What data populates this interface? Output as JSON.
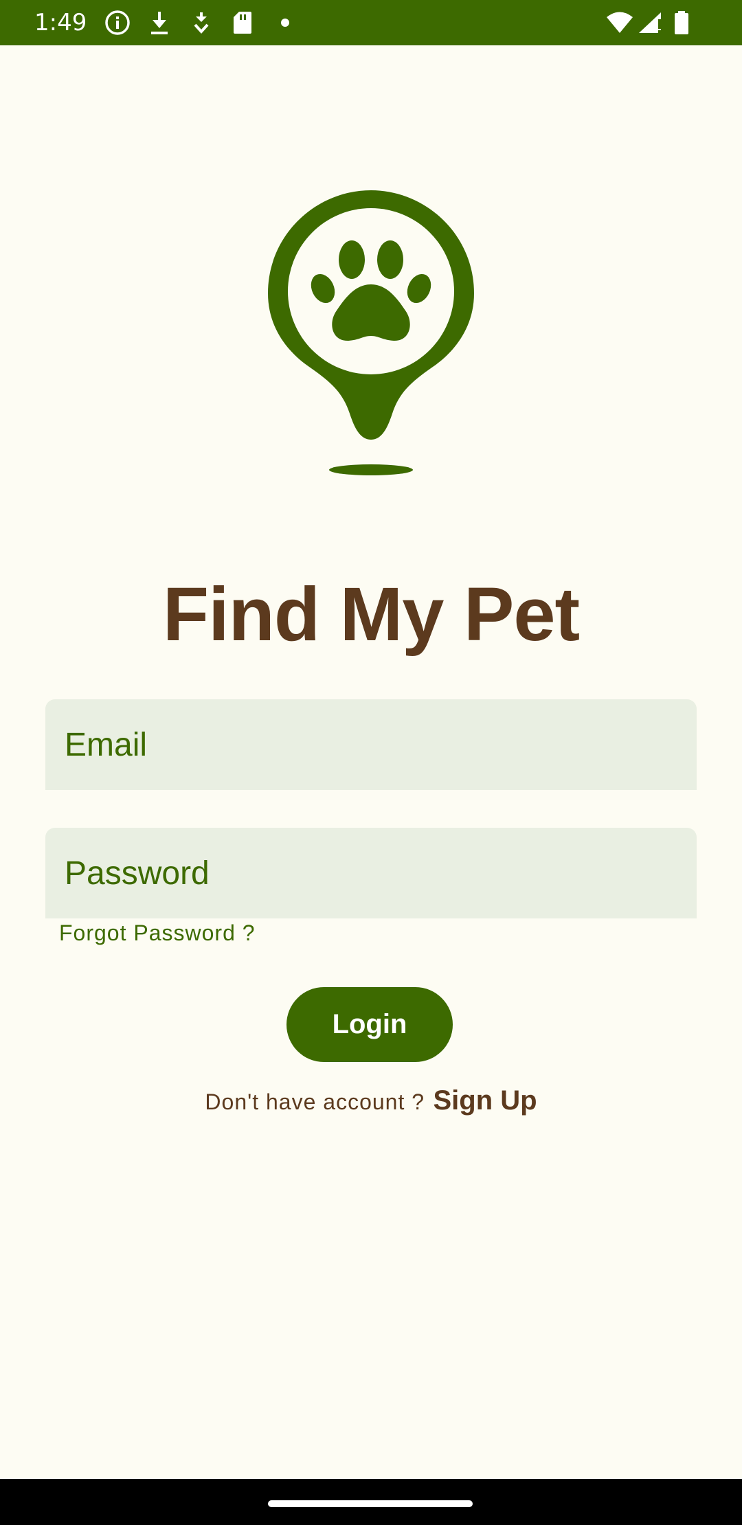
{
  "status_bar": {
    "time": "1:49",
    "icons": [
      "info-icon",
      "download-icon",
      "download-alt-icon",
      "sd-card-icon",
      "dot-icon",
      "wifi-icon",
      "signal-icon",
      "battery-icon"
    ]
  },
  "app": {
    "title": "Find My Pet"
  },
  "form": {
    "email_placeholder": "Email",
    "password_placeholder": "Password",
    "forgot_password": "Forgot Password ?",
    "login_label": "Login",
    "signup_prompt": "Don't have account ?",
    "signup_label": "Sign Up"
  },
  "colors": {
    "primary_green": "#3d6a00",
    "brown": "#5c3a1e",
    "field_bg": "#e9efe2",
    "background": "#fdfcf3"
  }
}
